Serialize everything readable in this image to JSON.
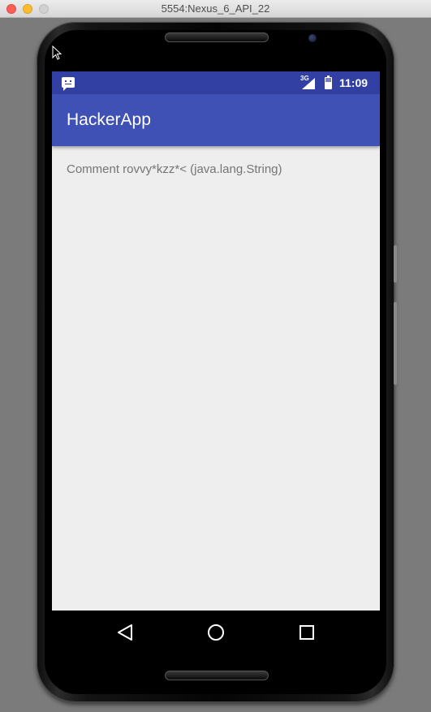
{
  "window": {
    "title": "5554:Nexus_6_API_22"
  },
  "status_bar": {
    "notification_icon": "message-notification-icon",
    "network_label": "3G",
    "time": "11:09"
  },
  "app_bar": {
    "title": "HackerApp"
  },
  "content": {
    "comment_text": "Comment rovvy*kzz*< (java.lang.String)"
  },
  "nav_bar": {
    "back_icon": "back-triangle-icon",
    "home_icon": "home-circle-icon",
    "recents_icon": "recents-square-icon"
  },
  "colors": {
    "status_bar": "#3340a3",
    "app_bar": "#3f51b5",
    "screen_background": "#eeeeee",
    "content_text": "#757575"
  }
}
